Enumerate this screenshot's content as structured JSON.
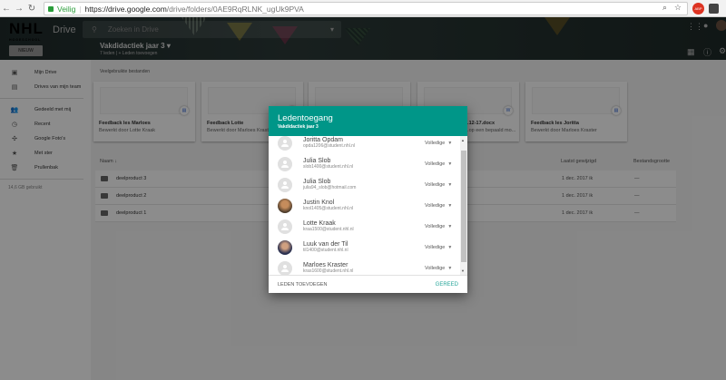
{
  "browser": {
    "secure_label": "Veilig",
    "url_host": "https://drive.google.com",
    "url_path": "/drive/folders/0AE9RqRLNK_ugUk9PVA",
    "ext1": "ABP"
  },
  "header": {
    "logo": "NHL",
    "logo_sub": "HOGESCHOOL",
    "app": "Drive",
    "search_placeholder": "Zoeken in Drive",
    "new_button": "NIEUW",
    "team_name": "Vakdidactiek jaar 3 ▾",
    "team_sub": "7 leden  |  + Leden toevoegen"
  },
  "sidebar": {
    "items": [
      {
        "label": "Mijn Drive",
        "icon": "drive-icon"
      },
      {
        "label": "Drives van mijn team",
        "icon": "team-drive-icon"
      },
      {
        "label": "Gedeeld met mij",
        "icon": "people-icon"
      },
      {
        "label": "Recent",
        "icon": "clock-icon"
      },
      {
        "label": "Google Foto's",
        "icon": "photos-icon"
      },
      {
        "label": "Met ster",
        "icon": "star-icon"
      },
      {
        "label": "Prullenbak",
        "icon": "trash-icon"
      }
    ],
    "usage": "14,6 GB gebruikt"
  },
  "main": {
    "section_title": "Veelgebruikte bestanden",
    "cards": [
      {
        "title": "Feedback les Marloes",
        "subtitle": "Bewerkt door Lotte Kraak"
      },
      {
        "title": "Feedback Lotte",
        "subtitle": "Bewerkt door Marloes Kraster"
      },
      {
        "title": "",
        "subtitle": ""
      },
      {
        "title": "...12-17.docx",
        "subtitle": "...op een bepaald mo..."
      },
      {
        "title": "Feedback les Joritta",
        "subtitle": "Bewerkt door Marloes Kraster"
      }
    ],
    "columns": {
      "name": "Naam ↓",
      "modified": "Laatst gewijzigd",
      "size": "Bestandsgrootte"
    },
    "rows": [
      {
        "name": "deelproduct 3",
        "modified": "1 dec. 2017 ik",
        "size": "—"
      },
      {
        "name": "deelproduct 2",
        "modified": "1 dec. 2017 ik",
        "size": "—"
      },
      {
        "name": "deelproduct 1",
        "modified": "1 dec. 2017 ik",
        "size": "—"
      }
    ]
  },
  "dialog": {
    "title": "Ledentoegang",
    "subtitle": "Vakdidactiek jaar 3",
    "add_members": "LEDEN TOEVOEGEN",
    "done": "GEREED",
    "members": [
      {
        "name": "Joritta Opdam",
        "email": "opda1206@student.nhl.nl",
        "role": "Volledige"
      },
      {
        "name": "Julia Slob",
        "email": "slob1400@student.nhl.nl",
        "role": "Volledige"
      },
      {
        "name": "Julia Slob",
        "email": "julia94_slob@hotmail.com",
        "role": "Volledige"
      },
      {
        "name": "Justin Knol",
        "email": "knol1405@student.nhl.nl",
        "role": "Volledige"
      },
      {
        "name": "Lotte Kraak",
        "email": "kraa1500@student.nhl.nl",
        "role": "Volledige"
      },
      {
        "name": "Luuk van der Til",
        "email": "til1400@student.nhl.nl",
        "role": "Volledige"
      },
      {
        "name": "Marloes Kraster",
        "email": "kras1600@student.nhl.nl",
        "role": "Volledige"
      }
    ]
  },
  "colors": {
    "accent": "#009688",
    "done": "#26a69a"
  }
}
